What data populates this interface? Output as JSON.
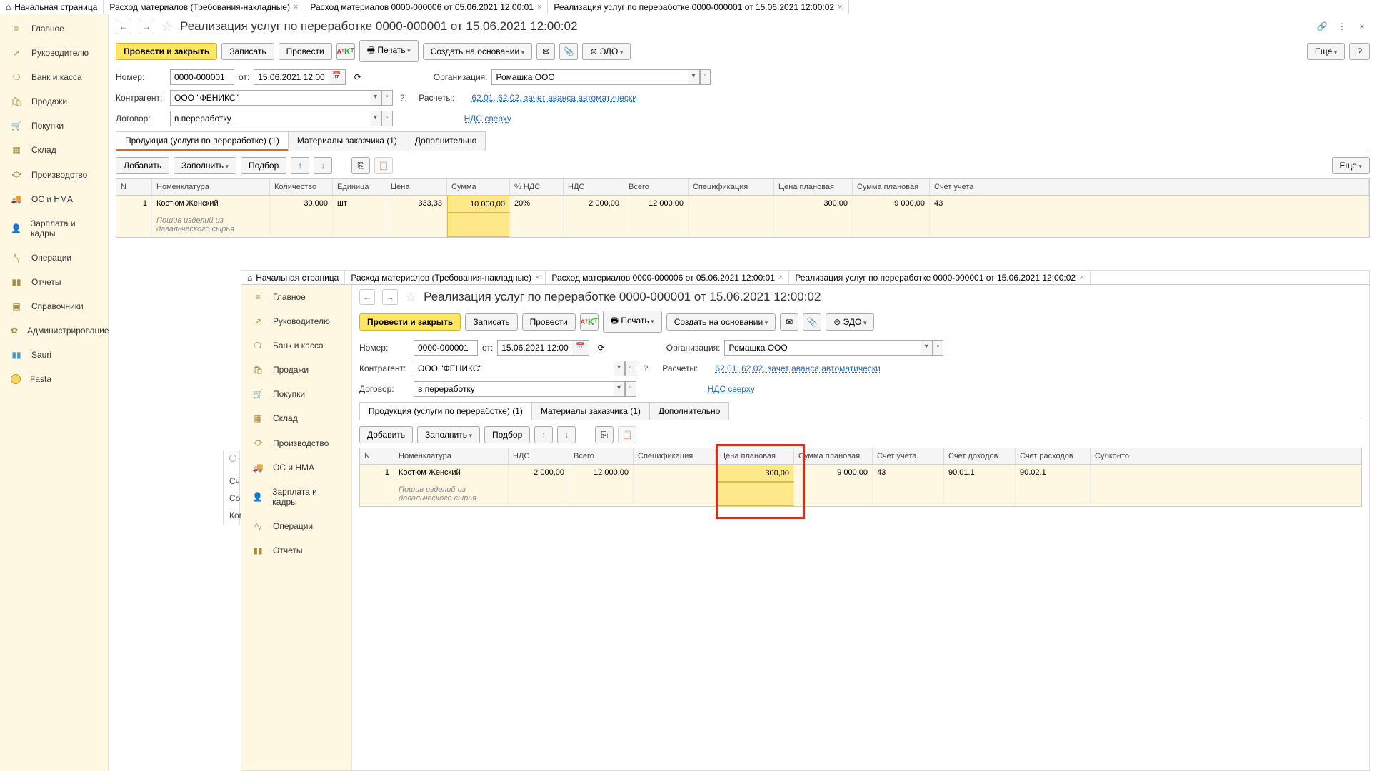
{
  "top_tabs": [
    {
      "label": "Начальная страница",
      "icon": "⌂",
      "closable": false
    },
    {
      "label": "Расход материалов (Требования-накладные)",
      "closable": true
    },
    {
      "label": "Расход материалов 0000-000006 от 05.06.2021 12:00:01",
      "closable": true
    },
    {
      "label": "Реализация услуг по переработке 0000-000001 от 15.06.2021 12:00:02",
      "closable": true,
      "active": true
    }
  ],
  "sidebar": [
    {
      "icon": "⌂",
      "label": "Главное"
    },
    {
      "icon": "↗",
      "label": "Руководителю"
    },
    {
      "icon": "❍",
      "label": "Банк и касса"
    },
    {
      "icon": "🛒",
      "label": "Продажи"
    },
    {
      "icon": "🛒",
      "label": "Покупки"
    },
    {
      "icon": "▦",
      "label": "Склад"
    },
    {
      "icon": "⛮",
      "label": "Производство"
    },
    {
      "icon": "🚚",
      "label": "ОС и НМА"
    },
    {
      "icon": "👤",
      "label": "Зарплата и кадры"
    },
    {
      "icon": "ᴬᵧ",
      "label": "Операции"
    },
    {
      "icon": "▮▮",
      "label": "Отчеты"
    },
    {
      "icon": "▣",
      "label": "Справочники"
    },
    {
      "icon": "✿",
      "label": "Администрирование"
    },
    {
      "icon": "▮▮",
      "label": "Sauri",
      "class": "sauri"
    },
    {
      "icon": "",
      "label": "Fasta",
      "class": "fasta"
    }
  ],
  "page": {
    "title": "Реализация услуг по переработке 0000-000001 от 15.06.2021 12:00:02",
    "toolbar": {
      "post_close": "Провести и закрыть",
      "save": "Записать",
      "post": "Провести",
      "print": "Печать",
      "create_based": "Создать на основании",
      "edo": "ЭДО",
      "more": "Еще"
    },
    "form": {
      "number_label": "Номер:",
      "number": "0000-000001",
      "from_label": "от:",
      "date": "15.06.2021 12:00:02",
      "org_label": "Организация:",
      "org": "Ромашка ООО",
      "counterparty_label": "Контрагент:",
      "counterparty": "ООО \"ФЕНИКС\"",
      "calc_label": "Расчеты:",
      "calc_link": "62.01, 62.02, зачет аванса автоматически",
      "contract_label": "Договор:",
      "contract": "в переработку",
      "nds_link": "НДС сверху"
    },
    "tabs": [
      "Продукция (услуги по переработке) (1)",
      "Материалы заказчика (1)",
      "Дополнительно"
    ],
    "sub_toolbar": {
      "add": "Добавить",
      "fill": "Заполнить",
      "select": "Подбор",
      "more": "Еще"
    },
    "grid": {
      "headers": [
        "N",
        "Номенклатура",
        "Количество",
        "Единица",
        "Цена",
        "Сумма",
        "% НДС",
        "НДС",
        "Всего",
        "Спецификация",
        "Цена плановая",
        "Сумма плановая",
        "Счет учета"
      ],
      "row": {
        "n": "1",
        "nomen": "Костюм Женский",
        "qty": "30,000",
        "unit": "шт",
        "price": "333,33",
        "sum": "10 000,00",
        "nds_pct": "20%",
        "nds": "2 000,00",
        "total": "12 000,00",
        "spec": "",
        "plan_price": "300,00",
        "plan_sum": "9 000,00",
        "account": "43",
        "subtext": "Пошив изделий из давальческого сырья"
      }
    }
  },
  "inner": {
    "grid": {
      "headers": [
        "N",
        "Номенклатура",
        "НДС",
        "Всего",
        "Спецификация",
        "Цена плановая",
        "Сумма плановая",
        "Счет учета",
        "Счет доходов",
        "Счет расходов",
        "Субконто"
      ],
      "row": {
        "n": "1",
        "nomen": "Костюм Женский",
        "nds": "2 000,00",
        "total": "12 000,00",
        "spec": "",
        "plan_price": "300,00",
        "plan_sum": "9 000,00",
        "account": "43",
        "income": "90.01.1",
        "expense": "90.02.1",
        "subconto": "",
        "subtext": "Пошив изделий из давальческого сырья"
      }
    }
  },
  "truncated": {
    "l1": "Сч",
    "l2": "Сос",
    "l3": "Ком"
  }
}
